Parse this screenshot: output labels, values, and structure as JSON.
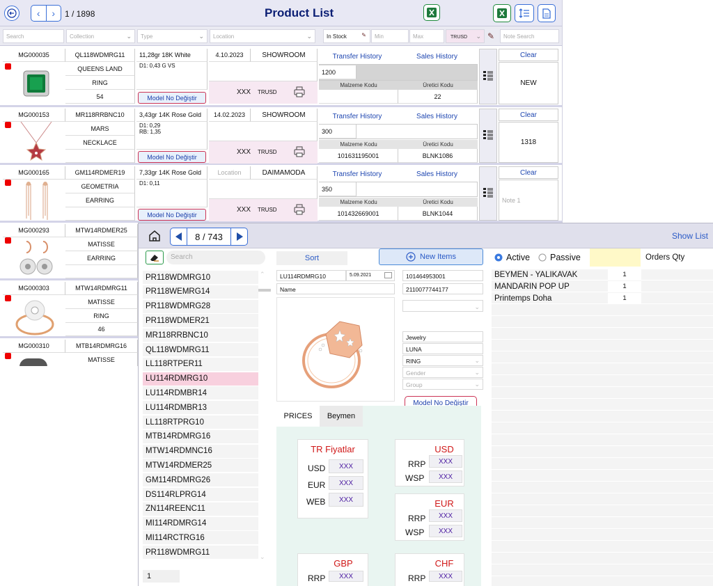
{
  "back": {
    "record_count": "1 / 1898",
    "title": "Product List",
    "filters": {
      "search": "Search",
      "collection": "Collection",
      "type": "Type",
      "location": "Location",
      "in_stock": "In Stock",
      "min": "Min",
      "max": "Max",
      "currency": "TRUSD",
      "note_search": "Note Search"
    },
    "common": {
      "model_button": "Model No Değiştir",
      "xxx": "XXX",
      "currency": "TRUSD",
      "transfer_history": "Transfer History",
      "sales_history": "Sales History",
      "malzeme_kodu": "Malzeme Kodu",
      "uretici_kodu": "Üretici Kodu",
      "clear": "Clear"
    },
    "rows": [
      {
        "id": "MG000035",
        "model": "QL118WDMRG11",
        "collection": "QUEENS LAND",
        "type": "RING",
        "qty": "54",
        "spec": "11,28gr 18K  White",
        "stones": "D1: 0,43 G VS",
        "date": "4.10.2023",
        "location": "SHOWROOM",
        "location_ph": false,
        "transfer_qty": "1200",
        "malzeme": "",
        "uretici": "22",
        "note": "NEW",
        "note_ph": false
      },
      {
        "id": "MG000153",
        "model": "MR118RRBNC10",
        "collection": "MARS",
        "type": "NECKLACE",
        "qty": "",
        "spec": "3,43gr 14K Rose Gold",
        "stones": "D1: 0,29\nRB: 1,35",
        "date": "14.02.2023",
        "location": "SHOWROOM",
        "location_ph": false,
        "transfer_qty": "300",
        "malzeme": "101631195001",
        "uretici": "BLNK1086",
        "note": "1318",
        "note_ph": false
      },
      {
        "id": "MG000165",
        "model": "GM114RDMER19",
        "collection": "GEOMETRIA",
        "type": "EARRING",
        "qty": "",
        "spec": "7,33gr 14K Rose Gold",
        "stones": "D1: 0,11",
        "date": "Location",
        "location": "DAIMAMODA",
        "location_ph": true,
        "transfer_qty": "350",
        "malzeme": "101432669001",
        "uretici": "BLNK1044",
        "note": "Note 1",
        "note_ph": true
      },
      {
        "id": "MG000293",
        "model": "MTW14RDMER25",
        "collection": "MATISSE",
        "type": "EARRING",
        "qty": ""
      },
      {
        "id": "MG000303",
        "model": "MTW14RDMRG11",
        "collection": "MATISSE",
        "type": "RING",
        "qty": "46"
      },
      {
        "id": "MG000310",
        "model": "MTB14RDMRG16",
        "collection": "MATISSE",
        "type": "",
        "qty": ""
      }
    ]
  },
  "front": {
    "counter": "8 / 743",
    "show_list": "Show List",
    "search_placeholder": "Search",
    "sort": "Sort",
    "new_items": "New Items",
    "active": "Active",
    "passive": "Passive",
    "orders_qty": "Orders Qty",
    "page_number": "1",
    "list": [
      "PR118WDMRG10",
      "PR118WEMRG14",
      "PR118WDMRG28",
      "PR118WDMER21",
      "MR118RRBNC10",
      "QL118WDMRG11",
      "LL118RTPER11",
      "LU114RDMRG10",
      "LU114RDMBR14",
      "LU114RDMBR13",
      "LL118RTPRG10",
      "MTB14RDMRG16",
      "MTW14RDMNC16",
      "MTW14RDMER25",
      "GM114RDMRG26",
      "DS114RLPRG14",
      "ZN114REENC11",
      "MI114RDMRG14",
      "MI114RCTRG16",
      "PR118WDMRG11"
    ],
    "selected_index": 7,
    "detail": {
      "model": "LU114RDMRG10",
      "date": "5.09.2021",
      "barcode1": "101464953001",
      "barcode2": "2110077744177",
      "name_placeholder": "Name",
      "category": "Jewelry",
      "collection": "LUNA",
      "type": "RING",
      "gender_placeholder": "Gender",
      "group_placeholder": "Group",
      "model_button": "Model No Değiştir"
    },
    "tabs": [
      "PRICES",
      "Beymen"
    ],
    "prices": {
      "tr_title": "TR Fiyatlar",
      "tr_rows": [
        {
          "label": "USD",
          "value": "XXX"
        },
        {
          "label": "EUR",
          "value": "XXX"
        },
        {
          "label": "WEB",
          "value": "XXX"
        }
      ],
      "usd_title": "USD",
      "usd_rows": [
        {
          "label": "RRP",
          "value": "XXX"
        },
        {
          "label": "WSP",
          "value": "XXX"
        }
      ],
      "eur_title": "EUR",
      "eur_rows": [
        {
          "label": "RRP",
          "value": "XXX"
        },
        {
          "label": "WSP",
          "value": "XXX"
        }
      ],
      "gbp_title": "GBP",
      "gbp_rows": [
        {
          "label": "RRP",
          "value": "XXX"
        }
      ],
      "chf_title": "CHF",
      "chf_rows": [
        {
          "label": "RRP",
          "value": "XXX"
        }
      ]
    },
    "orders": [
      {
        "store": "BEYMEN - YALIKAVAK",
        "qty": "1"
      },
      {
        "store": "MANDARIN POP UP",
        "qty": "1"
      },
      {
        "store": "Printemps Doha",
        "qty": "1"
      }
    ]
  },
  "colors": {
    "accent": "#2a5ac6",
    "brand_navy": "#0b1e74",
    "selected_row": "#f8d0de",
    "alert_red": "#e00000"
  }
}
